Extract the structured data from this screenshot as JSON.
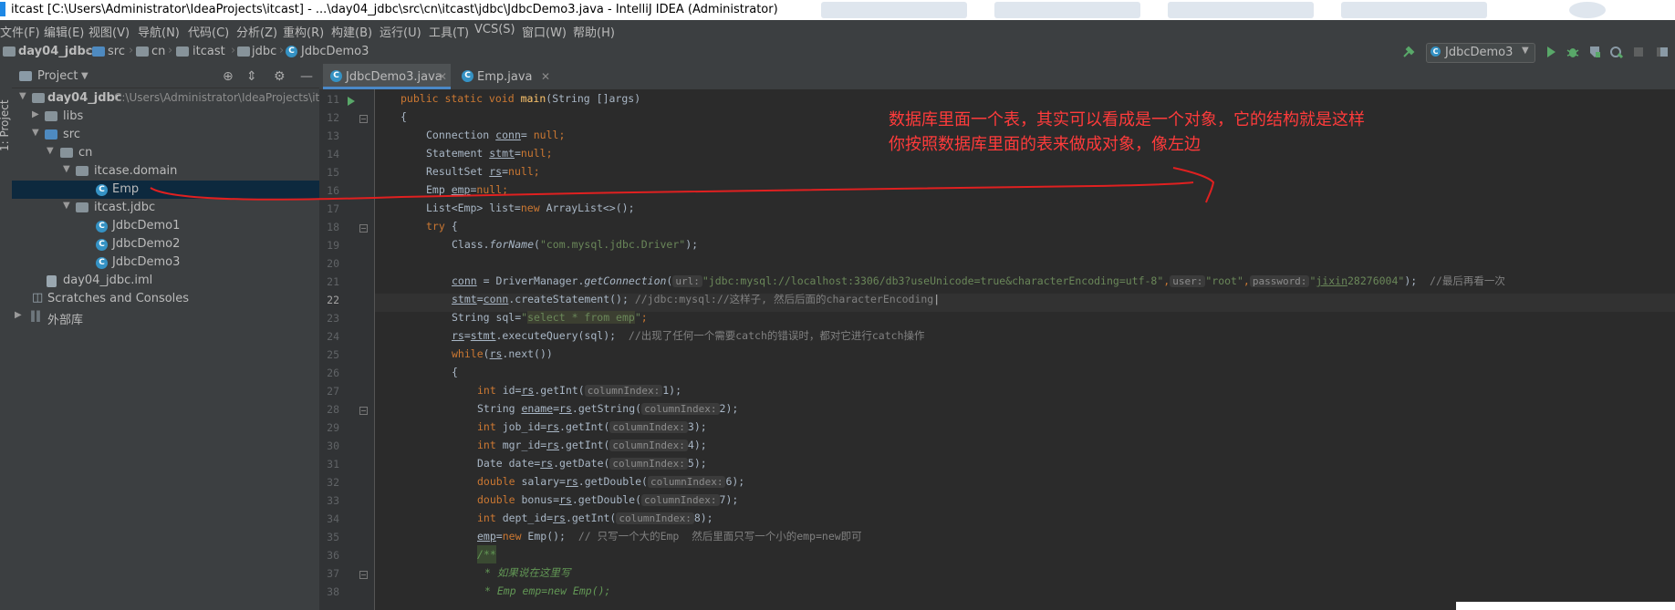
{
  "window": {
    "title": "itcast [C:\\Users\\Administrator\\IdeaProjects\\itcast] - ...\\day04_jdbc\\src\\cn\\itcast\\jdbc\\JdbcDemo3.java - IntelliJ IDEA (Administrator)"
  },
  "menu": [
    "文件(F)",
    "编辑(E)",
    "视图(V)",
    "导航(N)",
    "代码(C)",
    "分析(Z)",
    "重构(R)",
    "构建(B)",
    "运行(U)",
    "工具(T)",
    "VCS(S)",
    "窗口(W)",
    "帮助(H)"
  ],
  "breadcrumb": [
    "day04_jdbc",
    "src",
    "cn",
    "itcast",
    "jdbc",
    "JdbcDemo3"
  ],
  "run_config": "JdbcDemo3",
  "project_panel": {
    "title": "Project",
    "strip_label": "1: Project",
    "tree": [
      {
        "label": "day04_jdbc",
        "path": "C:\\Users\\Administrator\\IdeaProjects\\itc"
      },
      {
        "label": "libs"
      },
      {
        "label": "src"
      },
      {
        "label": "cn"
      },
      {
        "label": "itcase.domain"
      },
      {
        "label": "Emp"
      },
      {
        "label": "itcast.jdbc"
      },
      {
        "label": "JdbcDemo1"
      },
      {
        "label": "JdbcDemo2"
      },
      {
        "label": "JdbcDemo3"
      },
      {
        "label": "day04_jdbc.iml"
      },
      {
        "label": "Scratches and Consoles"
      },
      {
        "label": "外部库"
      }
    ]
  },
  "tabs": [
    {
      "label": "JdbcDemo3.java",
      "active": true
    },
    {
      "label": "Emp.java",
      "active": false
    }
  ],
  "line_numbers": [
    "11",
    "12",
    "13",
    "14",
    "15",
    "16",
    "17",
    "18",
    "19",
    "20",
    "21",
    "22",
    "23",
    "24",
    "25",
    "26",
    "27",
    "28",
    "29",
    "30",
    "31",
    "32",
    "33",
    "34",
    "35",
    "36",
    "37",
    "38"
  ],
  "current_line": "22",
  "annotation": {
    "line1": "数据库里面一个表，其实可以看成是一个对象，它的结构就是这样",
    "line2": "你按照数据库里面的表来做成对象，像左边"
  },
  "code": {
    "l11": [
      "public static void ",
      "main",
      "(String []args)"
    ],
    "l12": "{",
    "l13": [
      "Connection ",
      "conn",
      "= ",
      "null",
      ";"
    ],
    "l14": [
      "Statement ",
      "stmt",
      "=",
      "null",
      ";"
    ],
    "l15": [
      "ResultSet ",
      "rs",
      "=",
      "null",
      ";"
    ],
    "l16": [
      "Emp ",
      "emp",
      "=",
      "null",
      ";"
    ],
    "l17": [
      "List<Emp> list=",
      "new ",
      "ArrayList<>();"
    ],
    "l18": [
      "try ",
      "{"
    ],
    "l19": [
      "Class.",
      "forName",
      "(",
      "\"com.mysql.jdbc.Driver\"",
      ");"
    ],
    "l21": [
      "conn",
      " = DriverManager.",
      "getConnection",
      "(",
      "url:",
      "\"jdbc:mysql://localhost:3306/db3?useUnicode=true&characterEncoding=utf-8\"",
      ",",
      "user:",
      "\"root\"",
      ",",
      "password:",
      "\"",
      "jixin",
      "28276004\"",
      ");  ",
      "//最后再看一次"
    ],
    "l22": [
      "stmt",
      "=",
      "conn",
      ".createStatement(); ",
      "//jdbc:mysql://这样子, 然后后面的characterEncoding"
    ],
    "l23": [
      "String sql=",
      "\"",
      "select * from emp",
      "\"",
      ";"
    ],
    "l24": [
      "rs",
      "=",
      "stmt",
      ".executeQuery(sql);  ",
      "//出现了任何一个需要catch的错误时，都对它进行catch操作"
    ],
    "l25": [
      "while",
      "(",
      "rs",
      ".next())"
    ],
    "l26": "{",
    "l27": [
      "int ",
      "id=",
      "rs",
      ".getInt(",
      "columnIndex:",
      "1);"
    ],
    "l28": [
      "String ",
      "ename",
      "=",
      "rs",
      ".getString(",
      "columnIndex:",
      "2);"
    ],
    "l29": [
      "int ",
      "job_id=",
      "rs",
      ".getInt(",
      "columnIndex:",
      "3);"
    ],
    "l30": [
      "int ",
      "mgr_id=",
      "rs",
      ".getInt(",
      "columnIndex:",
      "4);"
    ],
    "l31": [
      "Date date=",
      "rs",
      ".getDate(",
      "columnIndex:",
      "5);"
    ],
    "l32": [
      "double ",
      "salary=",
      "rs",
      ".getDouble(",
      "columnIndex:",
      "6);"
    ],
    "l33": [
      "double ",
      "bonus=",
      "rs",
      ".getDouble(",
      "columnIndex:",
      "7);"
    ],
    "l34": [
      "int ",
      "dept_id=",
      "rs",
      ".getInt(",
      "columnIndex:",
      "8);"
    ],
    "l35": [
      "emp",
      "=",
      "new ",
      "Emp();  ",
      "// 只写一个大的Emp  然后里面只写一个小的emp=new即可"
    ],
    "l36": "/**",
    "l37": "* 如果说在这里写",
    "l38": "* Emp emp=new Emp();"
  },
  "colors": {
    "editor_bg": "#2b2b2b",
    "panel_bg": "#3c3f41",
    "keyword": "#cc7832",
    "string": "#6a8759",
    "comment": "#808080",
    "annotation_red": "#ff3b3b"
  }
}
